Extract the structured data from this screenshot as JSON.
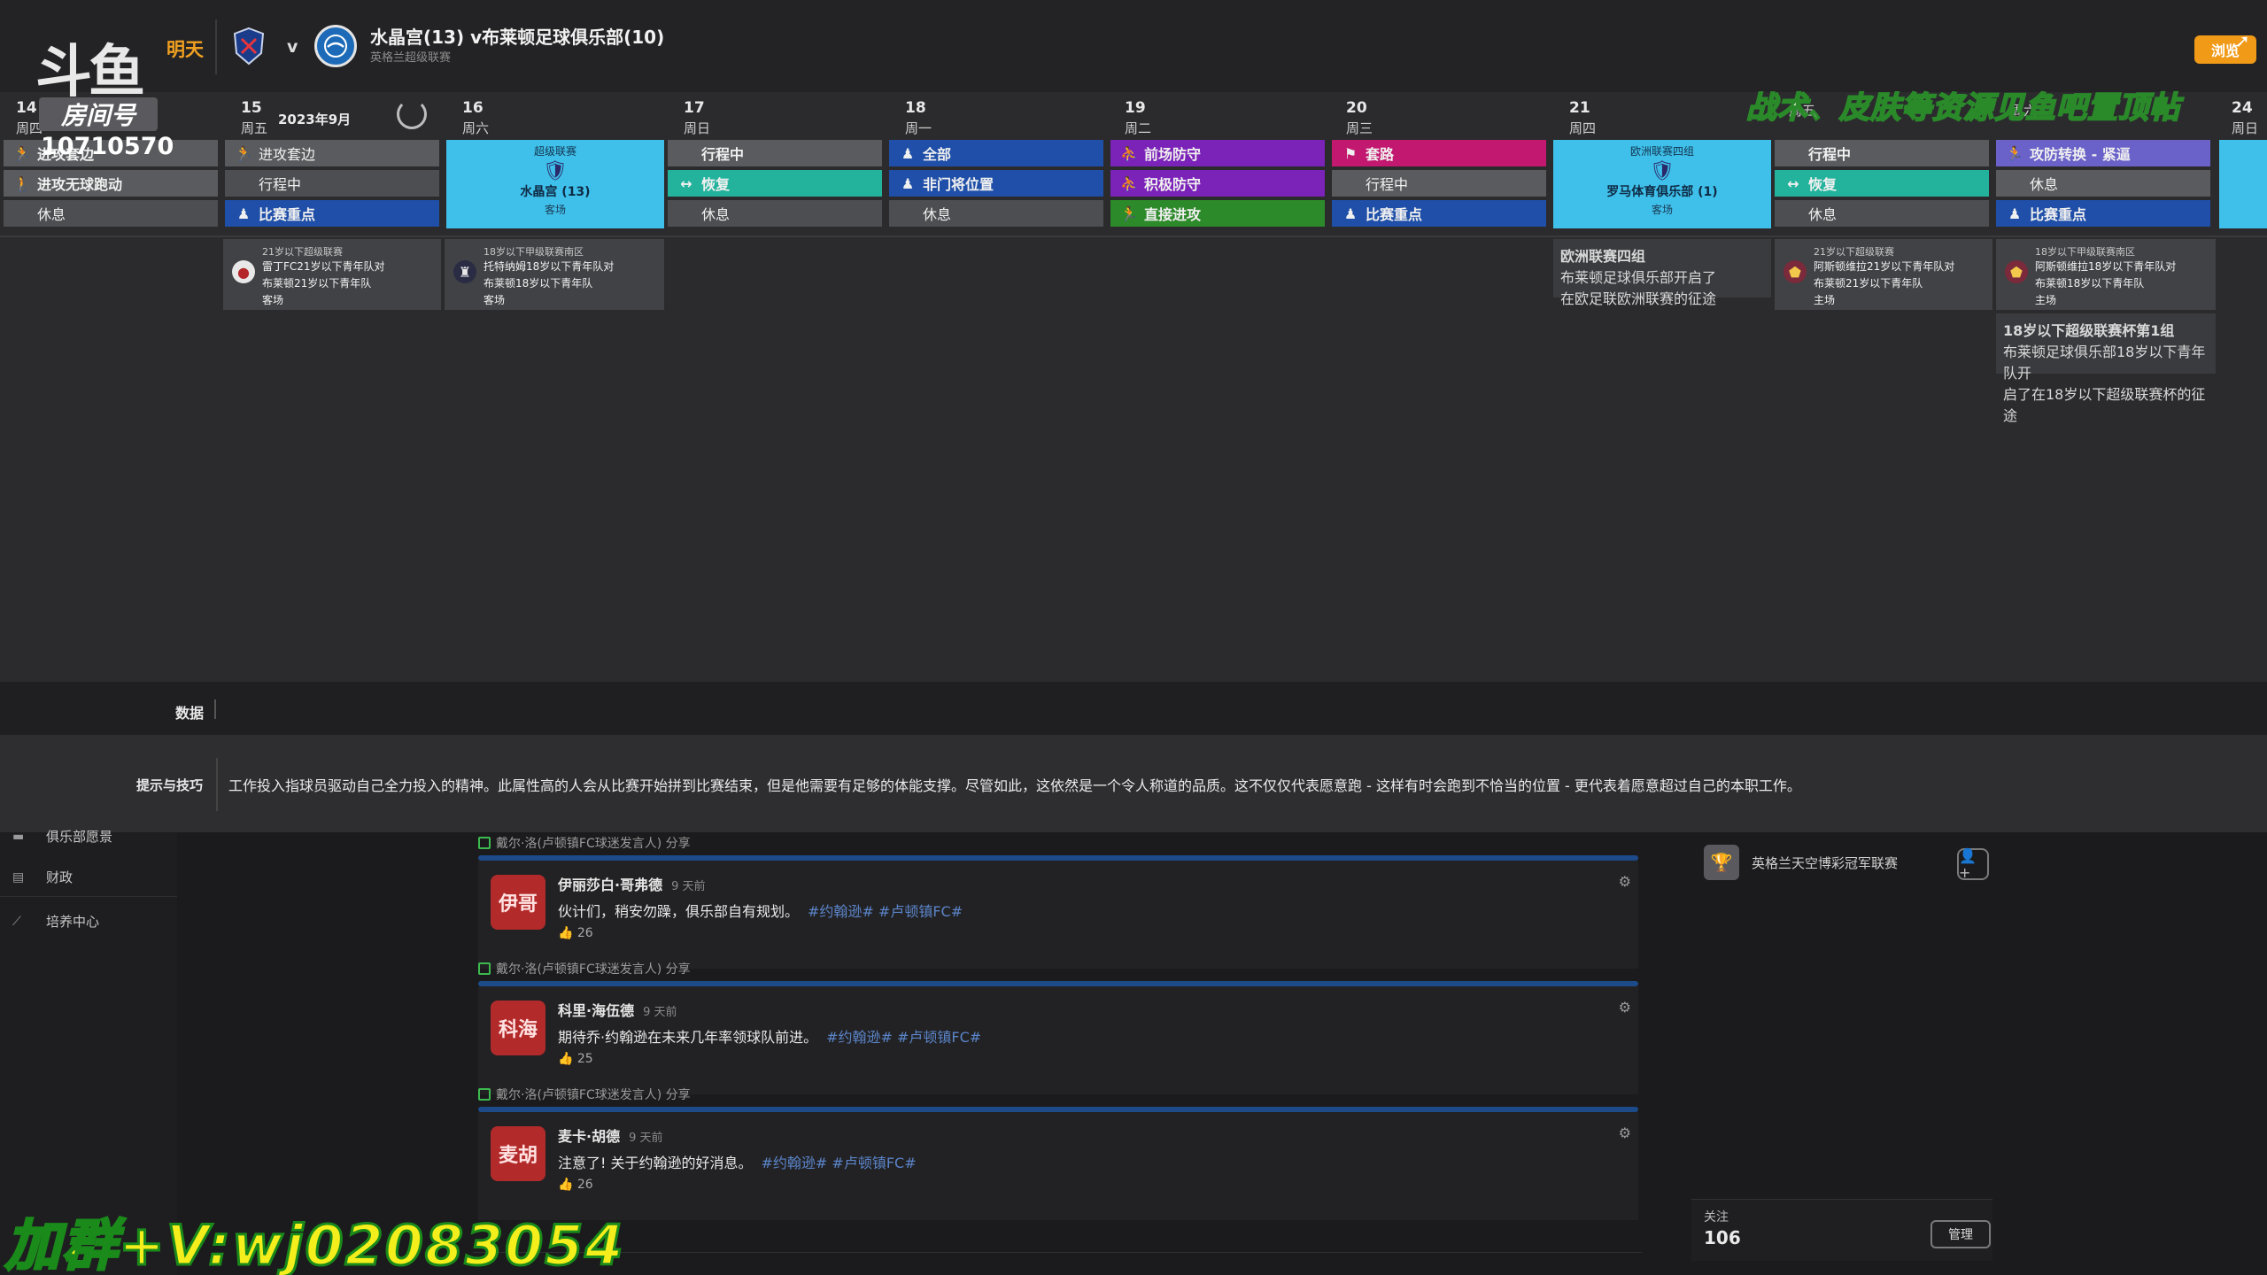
{
  "header": {
    "logo": "斗鱼",
    "tomorrow": "明天",
    "vs": "v",
    "match_title": "水晶宫(13) v布莱顿足球俱乐部(10)",
    "match_sub": "英格兰超级联赛",
    "top_button": "浏览",
    "month": "2023年9月"
  },
  "overlay": {
    "room_label": "房间号",
    "room_number": "10710570",
    "promo_top": "战术、皮肤等资源见鱼吧置顶帖",
    "promo_bottom": "加群+V:wj02083054"
  },
  "days": [
    {
      "num": "14",
      "week": "周四"
    },
    {
      "num": "15",
      "week": "周五"
    },
    {
      "num": "16",
      "week": "周六"
    },
    {
      "num": "17",
      "week": "周日"
    },
    {
      "num": "18",
      "week": "周一"
    },
    {
      "num": "19",
      "week": "周二"
    },
    {
      "num": "20",
      "week": "周三"
    },
    {
      "num": "21",
      "week": "周四"
    },
    {
      "num": "",
      "week": "周五"
    },
    {
      "num": "",
      "week": "周六"
    },
    {
      "num": "24",
      "week": "周日"
    }
  ],
  "slots": {
    "d14": [
      "进攻套边",
      "进攻无球跑动",
      "休息"
    ],
    "d15": [
      "进攻套边",
      "行程中",
      "比赛重点"
    ],
    "d17": [
      "行程中",
      "恢复",
      "休息"
    ],
    "d18": [
      "全部",
      "非门将位置",
      "休息"
    ],
    "d19": [
      "前场防守",
      "积极防守",
      "直接进攻"
    ],
    "d20": [
      "套路",
      "行程中",
      "比赛重点"
    ],
    "d22": [
      "行程中",
      "恢复",
      "休息"
    ],
    "d23": [
      "攻防转换 - 紧逼",
      "休息",
      "比赛重点"
    ]
  },
  "matches": {
    "m16": {
      "comp": "超级联赛",
      "team": "水晶宫 (13)",
      "venue": "客场"
    },
    "m21": {
      "comp": "欧洲联赛四组",
      "team": "罗马体育俱乐部 (1)",
      "venue": "客场"
    }
  },
  "events": {
    "e15": {
      "comp": "21岁以下超级联赛",
      "l1": "雷丁FC21岁以下青年队对",
      "l2": "布莱顿21岁以下青年队",
      "l3": "客场"
    },
    "e16": {
      "comp": "18岁以下甲级联赛南区",
      "l1": "托特纳姆18岁以下青年队对",
      "l2": "布莱顿18岁以下青年队",
      "l3": "客场"
    },
    "e21": {
      "l1": "欧洲联赛四组",
      "l2": "布莱顿足球俱乐部开启了",
      "l3": "在欧足联欧洲联赛的征途"
    },
    "e22": {
      "comp": "21岁以下超级联赛",
      "l1": "阿斯顿维拉21岁以下青年队对",
      "l2": "布莱顿21岁以下青年队",
      "l3": "主场"
    },
    "e23": {
      "comp": "18岁以下甲级联赛南区",
      "l1": "阿斯顿维拉18岁以下青年队对",
      "l2": "布莱顿18岁以下青年队",
      "l3": "主场"
    },
    "e23b": {
      "l1": "18岁以下超级联赛杯第1组",
      "l2": "布莱顿足球俱乐部18岁以下青年队开",
      "l3": "启了在18岁以下超级联赛杯的征途"
    }
  },
  "mid": {
    "data_label": "数据",
    "tips_label": "提示与技巧",
    "tips_text": "工作投入指球员驱动自己全力投入的精神。此属性高的人会从比赛开始拼到比赛结束，但是他需要有足够的体能支撑。尽管如此，这依然是一个令人称道的品质。这不仅仅代表愿意跑 - 这样有时会跑到不恰当的位置 - 更代表着愿意超过自己的本职工作。"
  },
  "nav": [
    {
      "label": "俱乐部愿景",
      "icon": "club-icon"
    },
    {
      "label": "财政",
      "icon": "finance-icon"
    },
    {
      "label": "培养中心",
      "icon": "development-icon"
    }
  ],
  "feed": {
    "share": "戴尔·洛(卢顿镇FC球迷发言人) 分享",
    "posts": [
      {
        "avatar": "伊哥",
        "author": "伊丽莎白·哥弗德",
        "time": "9 天前",
        "msg": "伙计们，稍安勿躁，俱乐部自有规划。",
        "tags": "#约翰逊# #卢顿镇FC#",
        "likes": "26"
      },
      {
        "avatar": "科海",
        "author": "科里·海伍德",
        "time": "9 天前",
        "msg": "期待乔·约翰逊在未来几年率领球队前进。",
        "tags": "#约翰逊# #卢顿镇FC#",
        "likes": "25"
      },
      {
        "avatar": "麦胡",
        "author": "麦卡·胡德",
        "time": "9 天前",
        "msg": "注意了! 关于约翰逊的好消息。",
        "tags": "#约翰逊# #卢顿镇FC#",
        "likes": "26"
      }
    ]
  },
  "right": {
    "competition": "英格兰天空博彩冠军联赛",
    "follow_label": "关注",
    "follow_count": "106",
    "manage": "管理"
  }
}
